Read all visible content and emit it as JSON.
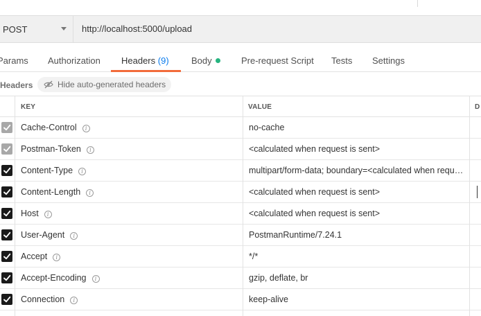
{
  "request": {
    "method": "POST",
    "url": "http://localhost:5000/upload"
  },
  "tabs": [
    {
      "label": "Params",
      "count": ""
    },
    {
      "label": "Authorization",
      "count": ""
    },
    {
      "label": "Headers",
      "count": "(9)"
    },
    {
      "label": "Body",
      "count": ""
    },
    {
      "label": "Pre-request Script",
      "count": ""
    },
    {
      "label": "Tests",
      "count": ""
    },
    {
      "label": "Settings",
      "count": ""
    }
  ],
  "active_tab": "Headers",
  "colors": {
    "accent": "#f26b3a",
    "body_dot": "#26b47f",
    "count": "#097bed"
  },
  "headers_section": {
    "label": "Headers",
    "hide_button": "Hide auto-generated headers",
    "hide_icon": "eye-slash-icon"
  },
  "table": {
    "columns": {
      "key": "KEY",
      "value": "VALUE",
      "description": "D"
    },
    "rows": [
      {
        "key": "Cache-Control",
        "value": "no-cache",
        "checked": true,
        "editable": false
      },
      {
        "key": "Postman-Token",
        "value": "<calculated when request is sent>",
        "checked": true,
        "editable": false
      },
      {
        "key": "Content-Type",
        "value": "multipart/form-data; boundary=<calculated when request is sent>",
        "checked": true,
        "editable": true
      },
      {
        "key": "Content-Length",
        "value": "<calculated when request is sent>",
        "checked": true,
        "editable": true
      },
      {
        "key": "Host",
        "value": "<calculated when request is sent>",
        "checked": true,
        "editable": true
      },
      {
        "key": "User-Agent",
        "value": "PostmanRuntime/7.24.1",
        "checked": true,
        "editable": true
      },
      {
        "key": "Accept",
        "value": "*/*",
        "checked": true,
        "editable": true
      },
      {
        "key": "Accept-Encoding",
        "value": "gzip, deflate, br",
        "checked": true,
        "editable": true
      },
      {
        "key": "Connection",
        "value": "keep-alive",
        "checked": true,
        "editable": true
      }
    ]
  }
}
